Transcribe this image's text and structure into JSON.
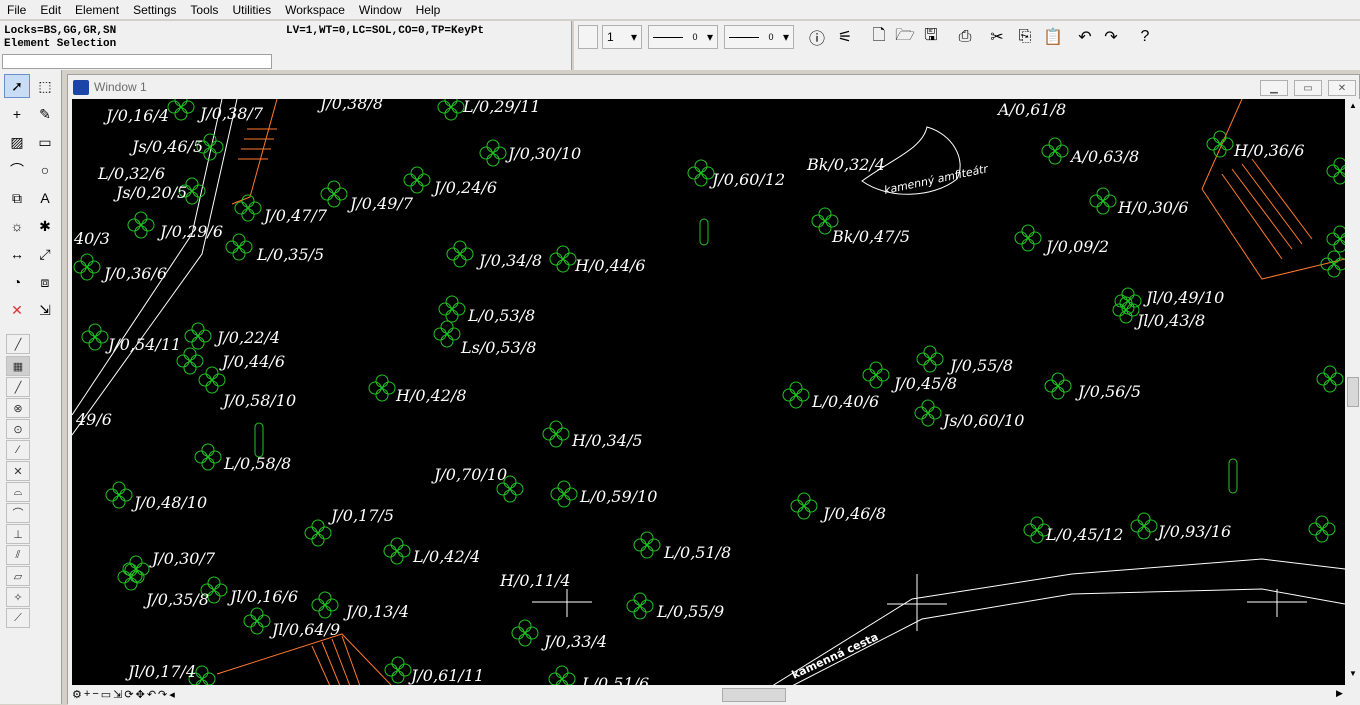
{
  "menu": [
    "File",
    "Edit",
    "Element",
    "Settings",
    "Tools",
    "Utilities",
    "Workspace",
    "Window",
    "Help"
  ],
  "status": {
    "locks": "Locks=BS,GG,GR,SN",
    "mode": "Element Selection",
    "attributes": "LV=1,WT=0,LC=SOL,CO=0,TP=KeyPt",
    "input_value": ""
  },
  "attributes_bar": {
    "level": "1",
    "style": "0",
    "weight": "0"
  },
  "toolbar_icons": [
    "info-icon",
    "fill-icon",
    "new-file-icon",
    "open-icon",
    "save-icon",
    "print-icon",
    "cut-icon",
    "copy-icon",
    "paste-icon",
    "undo-icon",
    "redo-icon",
    "help-icon"
  ],
  "window": {
    "title": "Window 1"
  },
  "drawing": {
    "labels": [
      "J/0,16/4",
      "J/0,38/7",
      "J/0,38/8",
      "L/0,29/11",
      "A/0,61/8",
      "Js/0,46/5",
      "J/0,30/10",
      "Bk/0,32/4",
      "A/0,63/8",
      "H/0,36/6",
      "L/0,32/6",
      "Js/0,20/5",
      "J/0,24/6",
      "J/0,60/12",
      "H/0,30/6",
      "J/0,47/7",
      "J/0,49/7",
      "Bk/0,47/5",
      "J/0,09/2",
      "40/3",
      "J/0,29/6",
      "L/0,35/5",
      "J/0,34/8",
      "H/0,44/6",
      "J/0,36/6",
      "Jl/0,49/10",
      "Jl/0,43/8",
      "L/0,53/8",
      "Ls/0,53/8",
      "J/0,54/11",
      "J/0,22/4",
      "J/0,44/6",
      "J/0,55/8",
      "J/0,45/8",
      "J/0,58/10",
      "H/0,42/8",
      "L/0,40/6",
      "J/0,56/5",
      "Js/0,60/10",
      "49/6",
      "H/0,34/5",
      "L/0,58/8",
      "J/0,70/10",
      "L/0,59/10",
      "J/0,48/10",
      "J/0,46/8",
      "J/0,17/5",
      "L/0,45/12",
      "J/0,93/16",
      "L/0,42/4",
      "L/0,51/8",
      "J/0,30/7",
      "H/0,11/4",
      "J/0,35/8",
      "Jl/0,16/6",
      "J/0,13/4",
      "L/0,55/9",
      "Jl/0,64/9",
      "J/0,33/4",
      "Jl/0,17/4",
      "J/0,61/11",
      "L/0,51/6"
    ],
    "amphitheater_label": "kamenný amfiteátr",
    "path_label": "kamenná cesta"
  }
}
